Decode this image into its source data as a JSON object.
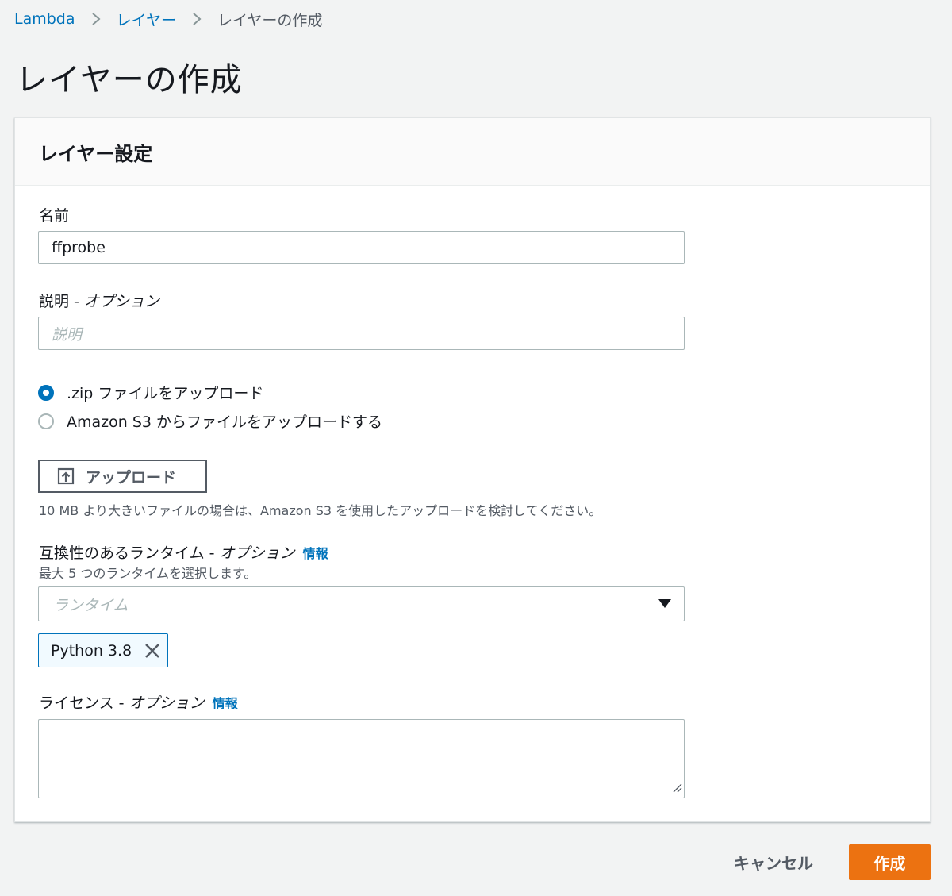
{
  "breadcrumb": {
    "items": [
      "Lambda",
      "レイヤー"
    ],
    "current": "レイヤーの作成"
  },
  "page_title": "レイヤーの作成",
  "panel": {
    "title": "レイヤー設定",
    "name": {
      "label": "名前",
      "value": "ffprobe"
    },
    "description": {
      "label": "説明 - ",
      "label_optional": "オプション",
      "placeholder": "説明"
    },
    "upload_source": {
      "options": [
        ".zip ファイルをアップロード",
        "Amazon S3 からファイルをアップロードする"
      ],
      "selected_index": 0
    },
    "upload_button": {
      "label": "アップロード",
      "icon": "upload-icon"
    },
    "upload_hint": "10 MB より大きいファイルの場合は、Amazon S3 を使用したアップロードを検討してください。",
    "runtimes": {
      "label": "互換性のあるランタイム - ",
      "label_optional": "オプション",
      "info": "情報",
      "hint": "最大 5 つのランタイムを選択します。",
      "placeholder": "ランタイム",
      "selected": [
        "Python 3.8"
      ]
    },
    "license": {
      "label": "ライセンス - ",
      "label_optional": "オプション",
      "info": "情報",
      "value": ""
    }
  },
  "footer": {
    "cancel_label": "キャンセル",
    "create_label": "作成"
  },
  "colors": {
    "accent": "#0073bb",
    "primary_button": "#ec7211",
    "background": "#f2f3f3"
  }
}
